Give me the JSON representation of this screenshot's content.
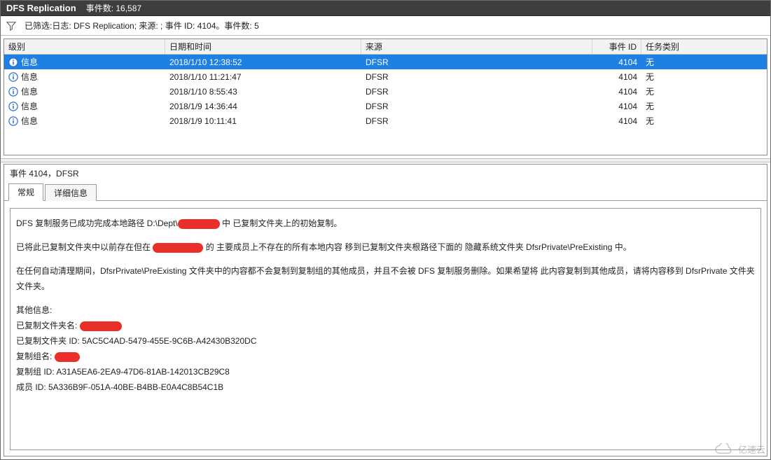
{
  "titlebar": {
    "title": "DFS Replication",
    "count_label": "事件数:",
    "count_value": "16,587"
  },
  "filter": {
    "text": "已筛选:日志: DFS Replication; 来源: ; 事件 ID: 4104。事件数: 5"
  },
  "columns": {
    "level": "级别",
    "datetime": "日期和时间",
    "source": "来源",
    "event_id": "事件 ID",
    "task_category": "任务类别"
  },
  "rows": [
    {
      "level": "信息",
      "datetime": "2018/1/10 12:38:52",
      "source": "DFSR",
      "event_id": "4104",
      "task_category": "无",
      "selected": true
    },
    {
      "level": "信息",
      "datetime": "2018/1/10 11:21:47",
      "source": "DFSR",
      "event_id": "4104",
      "task_category": "无",
      "selected": false
    },
    {
      "level": "信息",
      "datetime": "2018/1/10 8:55:43",
      "source": "DFSR",
      "event_id": "4104",
      "task_category": "无",
      "selected": false
    },
    {
      "level": "信息",
      "datetime": "2018/1/9 14:36:44",
      "source": "DFSR",
      "event_id": "4104",
      "task_category": "无",
      "selected": false
    },
    {
      "level": "信息",
      "datetime": "2018/1/9 10:11:41",
      "source": "DFSR",
      "event_id": "4104",
      "task_category": "无",
      "selected": false
    }
  ],
  "details": {
    "header": "事件 4104，DFSR",
    "tabs": {
      "general": "常规",
      "details": "详细信息"
    },
    "body": {
      "p1a": "DFS 复制服务已成功完成本地路径 D:\\Dept\\",
      "p1b": "中 已复制文件夹上的初始复制。",
      "p2a": "已将此已复制文件夹中以前存在但在 ",
      "p2b": "的 主要成员上不存在的所有本地内容 移到已复制文件夹根路径下面的 隐藏系统文件夹 DfsrPrivate\\PreExisting 中。",
      "p3": "在任何自动清理期间，DfsrPrivate\\PreExisting 文件夹中的内容都不会复制到复制组的其他成员，并且不会被 DFS 复制服务删除。如果希望将 此内容复制到其他成员，请将内容移到 DfsrPrivate 文件夹",
      "p3b": "文件夹。",
      "other_label": "其他信息:",
      "folder_name_label": "已复制文件夹名:",
      "folder_id": "已复制文件夹 ID: 5AC5C4AD-5479-455E-9C6B-A42430B320DC",
      "group_name_label": "复制组名:",
      "group_id": "复制组 ID: A31A5EA6-2EA9-47D6-81AB-142013CB29C8",
      "member_id": "成员 ID: 5A336B9F-051A-40BE-B4BB-E0A4C8B54C1B"
    }
  },
  "watermark": {
    "text": "亿速云"
  }
}
